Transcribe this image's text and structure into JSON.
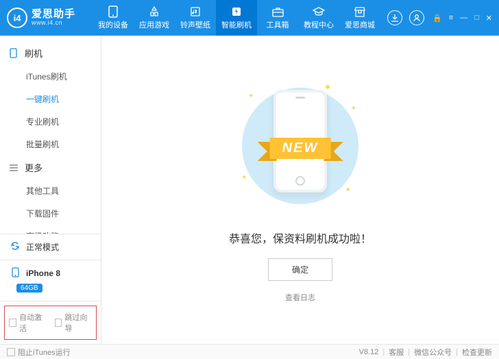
{
  "brand": {
    "name": "爱思助手",
    "url": "www.i4.cn",
    "logo": "i4"
  },
  "win": {
    "lock": "🔒",
    "menu": "≡",
    "min": "—",
    "max": "□",
    "close": "✕"
  },
  "topnav": [
    {
      "label": "我的设备",
      "active": false
    },
    {
      "label": "应用游戏",
      "active": false
    },
    {
      "label": "铃声壁纸",
      "active": false
    },
    {
      "label": "智能刷机",
      "active": true
    },
    {
      "label": "工具箱",
      "active": false
    },
    {
      "label": "教程中心",
      "active": false
    },
    {
      "label": "爱思商城",
      "active": false
    }
  ],
  "sidebar": {
    "groups": [
      {
        "title": "刷机",
        "items": [
          {
            "label": "iTunes刷机",
            "active": false
          },
          {
            "label": "一键刷机",
            "active": true
          },
          {
            "label": "专业刷机",
            "active": false
          },
          {
            "label": "批量刷机",
            "active": false
          }
        ]
      },
      {
        "title": "更多",
        "items": [
          {
            "label": "其他工具",
            "active": false
          },
          {
            "label": "下载固件",
            "active": false
          },
          {
            "label": "高级功能",
            "active": false
          }
        ]
      }
    ],
    "mode": "正常模式",
    "device": {
      "name": "iPhone 8",
      "storage": "64GB"
    },
    "checks": {
      "auto_activate": "自动激活",
      "skip_guide": "跳过向导"
    }
  },
  "main": {
    "ribbon": "NEW",
    "success": "恭喜您，保资料刷机成功啦！",
    "ok": "确定",
    "view_log": "查看日志"
  },
  "statusbar": {
    "block_itunes": "阻止iTunes运行",
    "version": "V8.12",
    "support": "客服",
    "wechat": "微信公众号",
    "check_update": "检查更新"
  }
}
